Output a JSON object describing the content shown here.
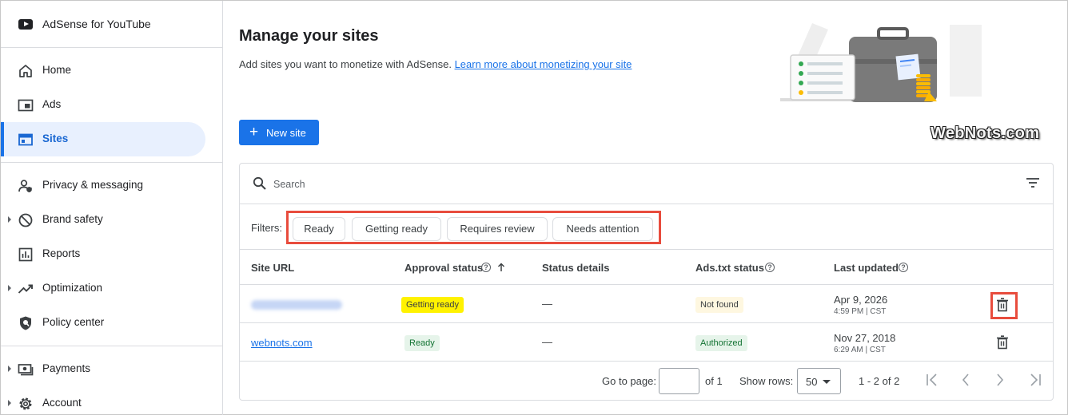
{
  "app": {
    "title": "AdSense for YouTube"
  },
  "sidebar": {
    "items": [
      {
        "label": "Home"
      },
      {
        "label": "Ads"
      },
      {
        "label": "Sites"
      },
      {
        "label": "Privacy & messaging"
      },
      {
        "label": "Brand safety"
      },
      {
        "label": "Reports"
      },
      {
        "label": "Optimization"
      },
      {
        "label": "Policy center"
      },
      {
        "label": "Payments"
      },
      {
        "label": "Account"
      }
    ],
    "active": "Sites"
  },
  "page": {
    "title": "Manage your sites",
    "description": "Add sites you want to monetize with AdSense.",
    "learn_more_link": "Learn more about monetizing your site",
    "new_site_label": "New site",
    "watermark": "WebNots.com"
  },
  "search": {
    "placeholder": "Search"
  },
  "filters": {
    "label": "Filters:",
    "chips": [
      "Ready",
      "Getting ready",
      "Requires review",
      "Needs attention"
    ]
  },
  "table": {
    "columns": {
      "site_url": "Site URL",
      "approval_status": "Approval status",
      "status_details": "Status details",
      "ads_txt_status": "Ads.txt status",
      "last_updated": "Last updated"
    },
    "rows": [
      {
        "site_url": "",
        "approval_status": "Getting ready",
        "status_details": "—",
        "ads_txt_status": "Not found",
        "date": "Apr 9, 2026",
        "time": "4:59 PM | CST"
      },
      {
        "site_url": "webnots.com",
        "approval_status": "Ready",
        "status_details": "—",
        "ads_txt_status": "Authorized",
        "date": "Nov 27, 2018",
        "time": "6:29 AM | CST"
      }
    ]
  },
  "pagination": {
    "go_to_page_label": "Go to page:",
    "of_pages": "of 1",
    "show_rows_label": "Show rows:",
    "rows_per_page": "50",
    "range": "1 - 2 of 2"
  },
  "colors": {
    "accent": "#1a73e8",
    "highlight_box": "#e84c3d",
    "getting_ready_bg": "#fff200",
    "ready_bg": "#e6f4ea",
    "not_found_bg": "#fef7e0",
    "authorized_bg": "#e6f4ea"
  },
  "icons": [
    "youtube-icon",
    "home-icon",
    "ads-icon",
    "sites-icon",
    "privacy-icon",
    "block-icon",
    "reports-icon",
    "trending-up-icon",
    "policy-shield-icon",
    "payments-icon",
    "gear-icon",
    "search-icon",
    "filter-icon",
    "help-icon",
    "arrow-up-icon",
    "delete-icon",
    "first-page-icon",
    "prev-page-icon",
    "next-page-icon",
    "last-page-icon"
  ]
}
